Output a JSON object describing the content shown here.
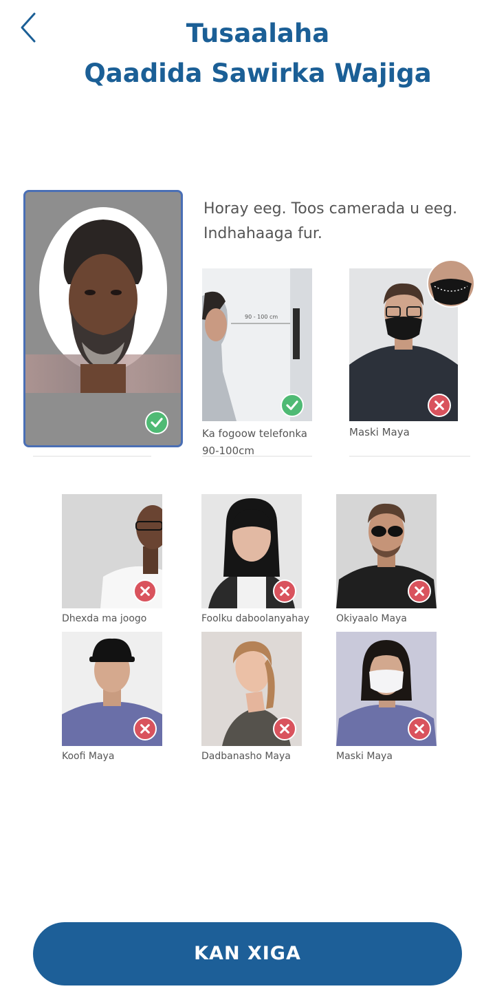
{
  "header": {
    "title_line1": "Tusaalaha",
    "title_line2": "Qaadida Sawirka Wajiga"
  },
  "instruction": "Horay eeg. Toos camerada u eeg. Indhahaaga fur.",
  "examples": [
    {
      "caption": "Ka fogoow telefonka 90-100cm",
      "status": "ok",
      "label_in_image": "90 - 100 cm"
    },
    {
      "caption": "Maski Maya",
      "status": "no"
    },
    {
      "caption": "Dhexda ma joogo",
      "status": "no"
    },
    {
      "caption": "Foolku daboolanyahay",
      "status": "no"
    },
    {
      "caption": "Okiyaalo Maya",
      "status": "no"
    },
    {
      "caption": "Koofi Maya",
      "status": "no"
    },
    {
      "caption": "Dadbanasho Maya",
      "status": "no"
    },
    {
      "caption": "Maski Maya",
      "status": "no"
    }
  ],
  "main_example": {
    "status": "ok"
  },
  "next_button": "KAN XIGA",
  "colors": {
    "primary": "#1d5f98",
    "ok": "#4fba74",
    "no": "#d9535d"
  }
}
